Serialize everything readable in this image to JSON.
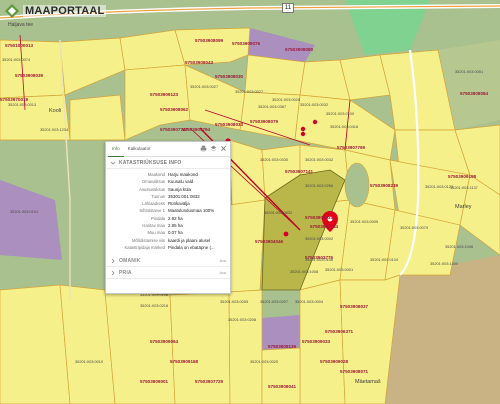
{
  "logo": {
    "text": "MAAPORTAAL",
    "superscript": "EE"
  },
  "road": {
    "name": "Haljava tee",
    "number": "11"
  },
  "places": {
    "kooli": "Kooli",
    "mariley": "Marley",
    "maetamasti": "Mäetamaš"
  },
  "cadastral_units": [
    "57501000013",
    "57503908039",
    "57503970019",
    "57503908099",
    "57503908043",
    "57503908076",
    "57503908080",
    "57503908030",
    "57503908062",
    "57503907794",
    "57503908033",
    "57503908079",
    "57503907769",
    "57503907747",
    "57503908239",
    "57503909123",
    "57503908144",
    "57503907141",
    "57503903776",
    "57503908031",
    "57503909033",
    "57503909028",
    "57503908037",
    "57503909139",
    "57503908071",
    "57503908041",
    "57503909064",
    "57503909168",
    "57503909001",
    "57503907729",
    "57503908084",
    "57503909198",
    "57503904046",
    "57503906371"
  ],
  "parcel_ids": [
    "35201:003:0074",
    "35201:003:1234",
    "35201:003:0013",
    "35201:003:0027",
    "35201:003:0028",
    "35201:003:0032",
    "35201:003:0100",
    "35201:003:0416",
    "35201:003:0387",
    "35201:003:0030",
    "35201:003:0032",
    "35201:003:0256",
    "35201:003:0051",
    "35201:003:1137",
    "35201:003:0832",
    "35201:003:0002",
    "35201:003:1008",
    "35201:003:0001",
    "35201:003:0106",
    "35201:003:0104",
    "35201:003:0004",
    "35201:003:0005",
    "35201:003:1046",
    "35201:003:0079",
    "35201:003:1300",
    "35201:003:0191",
    "35201:003:0108",
    "35201:003:0216",
    "35201:003:0055",
    "35201:003:0208",
    "35201:003:0207",
    "35201:003:0010",
    "35201:003:0020",
    "35201:003:0123",
    "35201:003:0027"
  ],
  "popup": {
    "tabs": [
      "Info",
      "Kalkulaator"
    ],
    "tool_icons": [
      "print-icon",
      "layers-icon",
      "close-icon"
    ],
    "section_title": "KATASTRIÜKSUSE INFO",
    "rows": [
      {
        "key": "Maakond",
        "value": "Harju maakond"
      },
      {
        "key": "Omavalitsus",
        "value": "Kuusalu vald"
      },
      {
        "key": "Asustusüksus",
        "value": "Saunja küla"
      },
      {
        "key": "Tunnus",
        "value": "35301:001:0832"
      },
      {
        "key": "Lähiaadress",
        "value": "Rünkaväljа"
      },
      {
        "key": "Sihtotstarve 1",
        "value": "Maatulundusmaa 100%"
      },
      {
        "key": "Pindala",
        "value": "2.92 ha"
      },
      {
        "key": "Haritav maa",
        "value": "2.85 ha"
      },
      {
        "key": "Muu maa",
        "value": "0.07 ha"
      },
      {
        "key": "Mõõdistamise viis",
        "value": "kaardi ja plaani alusel"
      },
      {
        "key": "Katastripidaja märked",
        "value": "Pindala on ebatäpne (..."
      }
    ],
    "sections_collapsed": [
      {
        "title": "OMANIK",
        "link": "Ava"
      },
      {
        "title": "PRIA",
        "link": "Ava"
      }
    ]
  },
  "colors": {
    "forest": "#a9c08f",
    "parcel": "#f6f08a",
    "highlight_parcel": "#b9b64a",
    "field": "#c9b283",
    "purple_zone": "#ab8fbf",
    "green_zone": "#7fd28f",
    "boundary_red": "#c0002a",
    "accent_green": "#3c7c2f"
  }
}
